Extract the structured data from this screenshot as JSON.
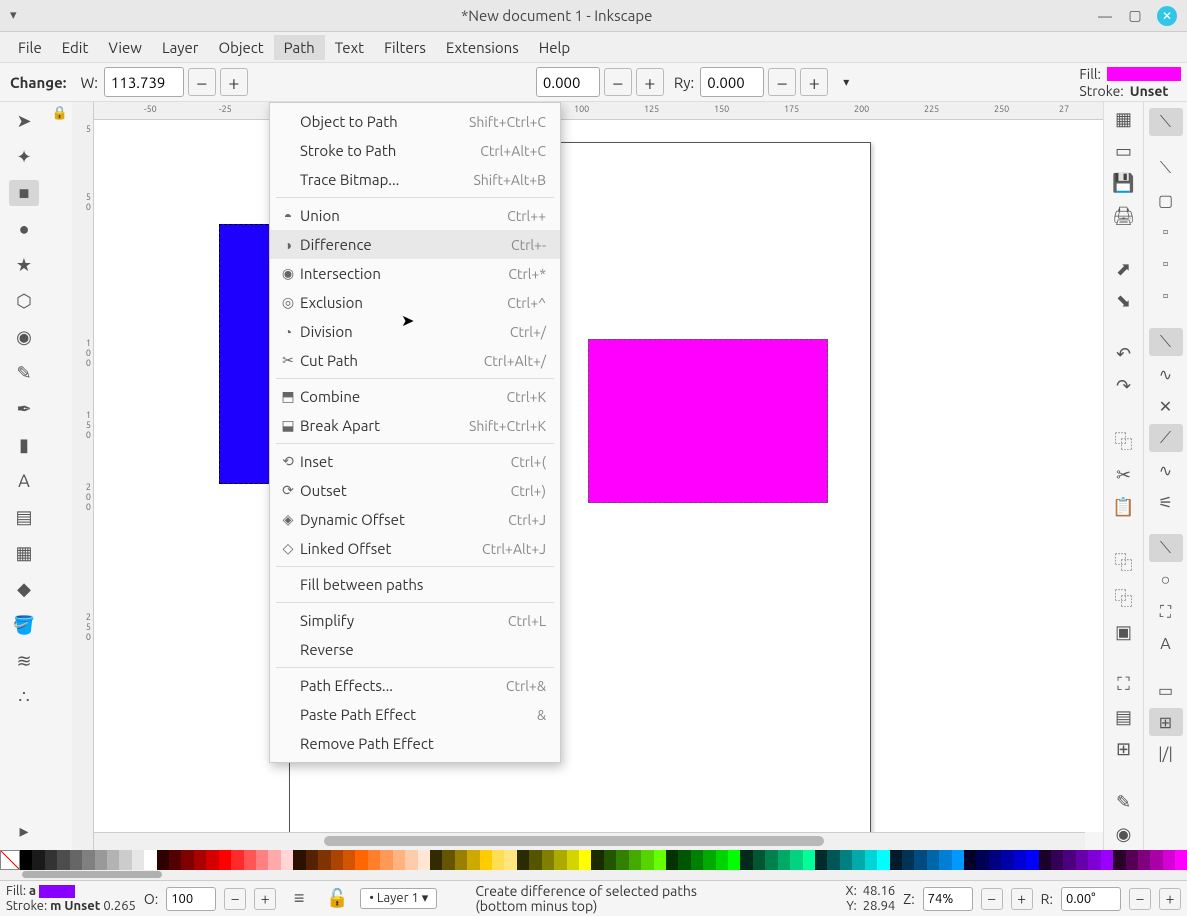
{
  "window": {
    "title": "*New document 1 - Inkscape"
  },
  "menubar": [
    "File",
    "Edit",
    "View",
    "Layer",
    "Object",
    "Path",
    "Text",
    "Filters",
    "Extensions",
    "Help"
  ],
  "active_menu_index": 5,
  "path_menu": {
    "groups": [
      [
        {
          "label": "Object to Path",
          "shortcut": "Shift+Ctrl+C",
          "icon": ""
        },
        {
          "label": "Stroke to Path",
          "shortcut": "Ctrl+Alt+C",
          "icon": ""
        },
        {
          "label": "Trace Bitmap...",
          "shortcut": "Shift+Alt+B",
          "icon": ""
        }
      ],
      [
        {
          "label": "Union",
          "shortcut": "Ctrl++",
          "icon": "◓"
        },
        {
          "label": "Difference",
          "shortcut": "Ctrl+-",
          "icon": "◑",
          "hover": true
        },
        {
          "label": "Intersection",
          "shortcut": "Ctrl+*",
          "icon": "◉"
        },
        {
          "label": "Exclusion",
          "shortcut": "Ctrl+^",
          "icon": "◎"
        },
        {
          "label": "Division",
          "shortcut": "Ctrl+/",
          "icon": "◔"
        },
        {
          "label": "Cut Path",
          "shortcut": "Ctrl+Alt+/",
          "icon": "✂"
        }
      ],
      [
        {
          "label": "Combine",
          "shortcut": "Ctrl+K",
          "icon": "⬒"
        },
        {
          "label": "Break Apart",
          "shortcut": "Shift+Ctrl+K",
          "icon": "⬓"
        }
      ],
      [
        {
          "label": "Inset",
          "shortcut": "Ctrl+(",
          "icon": "⟲"
        },
        {
          "label": "Outset",
          "shortcut": "Ctrl+)",
          "icon": "⟳"
        },
        {
          "label": "Dynamic Offset",
          "shortcut": "Ctrl+J",
          "icon": "◈"
        },
        {
          "label": "Linked Offset",
          "shortcut": "Ctrl+Alt+J",
          "icon": "◇"
        }
      ],
      [
        {
          "label": "Fill between paths",
          "shortcut": "",
          "icon": ""
        }
      ],
      [
        {
          "label": "Simplify",
          "shortcut": "Ctrl+L",
          "icon": ""
        },
        {
          "label": "Reverse",
          "shortcut": "",
          "icon": ""
        }
      ],
      [
        {
          "label": "Path Effects...",
          "shortcut": "Ctrl+&",
          "icon": ""
        },
        {
          "label": "Paste Path Effect",
          "shortcut": "&",
          "icon": ""
        },
        {
          "label": "Remove Path Effect",
          "shortcut": "",
          "icon": ""
        }
      ]
    ]
  },
  "toolbar": {
    "change_label": "Change:",
    "w_label": "W:",
    "w_value": "113.739",
    "rx_value": "0.000",
    "ry_label": "Ry:",
    "ry_value": "0.000",
    "fill_label": "Fill:",
    "fill_color": "#ff00ff",
    "stroke_label": "Stroke:",
    "stroke_value": "Unset"
  },
  "ruler_h": [
    "-50",
    "-25",
    "100",
    "125",
    "150",
    "175",
    "200",
    "225",
    "250",
    "27"
  ],
  "ruler_v": [
    "5",
    "5",
    "0",
    "1\n0\n0",
    "1\n5\n0",
    "2\n0\n0"
  ],
  "palette": [
    "#000000",
    "#1a1a1a",
    "#333333",
    "#4d4d4d",
    "#666666",
    "#808080",
    "#999999",
    "#b3b3b3",
    "#cccccc",
    "#e6e6e6",
    "#ffffff",
    "#2f0000",
    "#550000",
    "#800000",
    "#aa0000",
    "#d40000",
    "#ff0000",
    "#ff2a2a",
    "#ff5555",
    "#ff8080",
    "#ffaaaa",
    "#ffd5d5",
    "#2b1100",
    "#552200",
    "#803300",
    "#aa4400",
    "#d45500",
    "#ff6600",
    "#ff7f2a",
    "#ff9955",
    "#ffb380",
    "#ffccaa",
    "#ffe6d5",
    "#332b00",
    "#665500",
    "#998000",
    "#ccaa00",
    "#ffcc00",
    "#ffdd55",
    "#ffe680",
    "#2b2b00",
    "#555500",
    "#808000",
    "#aaaa00",
    "#d4d400",
    "#ffff00",
    "#1b2b00",
    "#225500",
    "#338000",
    "#44aa00",
    "#55d400",
    "#66ff00",
    "#003300",
    "#005500",
    "#008000",
    "#00aa00",
    "#00d400",
    "#00ff00",
    "#002b1a",
    "#005533",
    "#00804d",
    "#00aa66",
    "#00d480",
    "#00ff99",
    "#002b2b",
    "#005555",
    "#008080",
    "#00aaaa",
    "#00d4d4",
    "#00ffff",
    "#001b2b",
    "#003355",
    "#004c80",
    "#0066aa",
    "#007fd4",
    "#0099ff",
    "#00002b",
    "#000055",
    "#000080",
    "#0000aa",
    "#0000d4",
    "#0000ff",
    "#1b002b",
    "#330055",
    "#4c0080",
    "#6600aa",
    "#7f00d4",
    "#9900ff",
    "#2b002b",
    "#550055",
    "#800080",
    "#aa00aa",
    "#d400d4",
    "#ff00ff"
  ],
  "statusbar": {
    "fill_label": "Fill:",
    "fill_a": "a",
    "fill_swatch": "#8800ff",
    "stroke_label": "Stroke:",
    "stroke_m": "m",
    "stroke_value": "Unset",
    "stroke_num": "0.265",
    "opacity_label": "O:",
    "opacity_value": "100",
    "layer_label": "Layer 1",
    "hint_line1": "Create difference of selected paths",
    "hint_line2": "(bottom minus top)",
    "x_label": "X:",
    "x_value": "48.16",
    "y_label": "Y:",
    "y_value": "28.94",
    "z_label": "Z:",
    "zoom_value": "74%",
    "r_label": "R:",
    "rotation_value": "0.00°"
  }
}
